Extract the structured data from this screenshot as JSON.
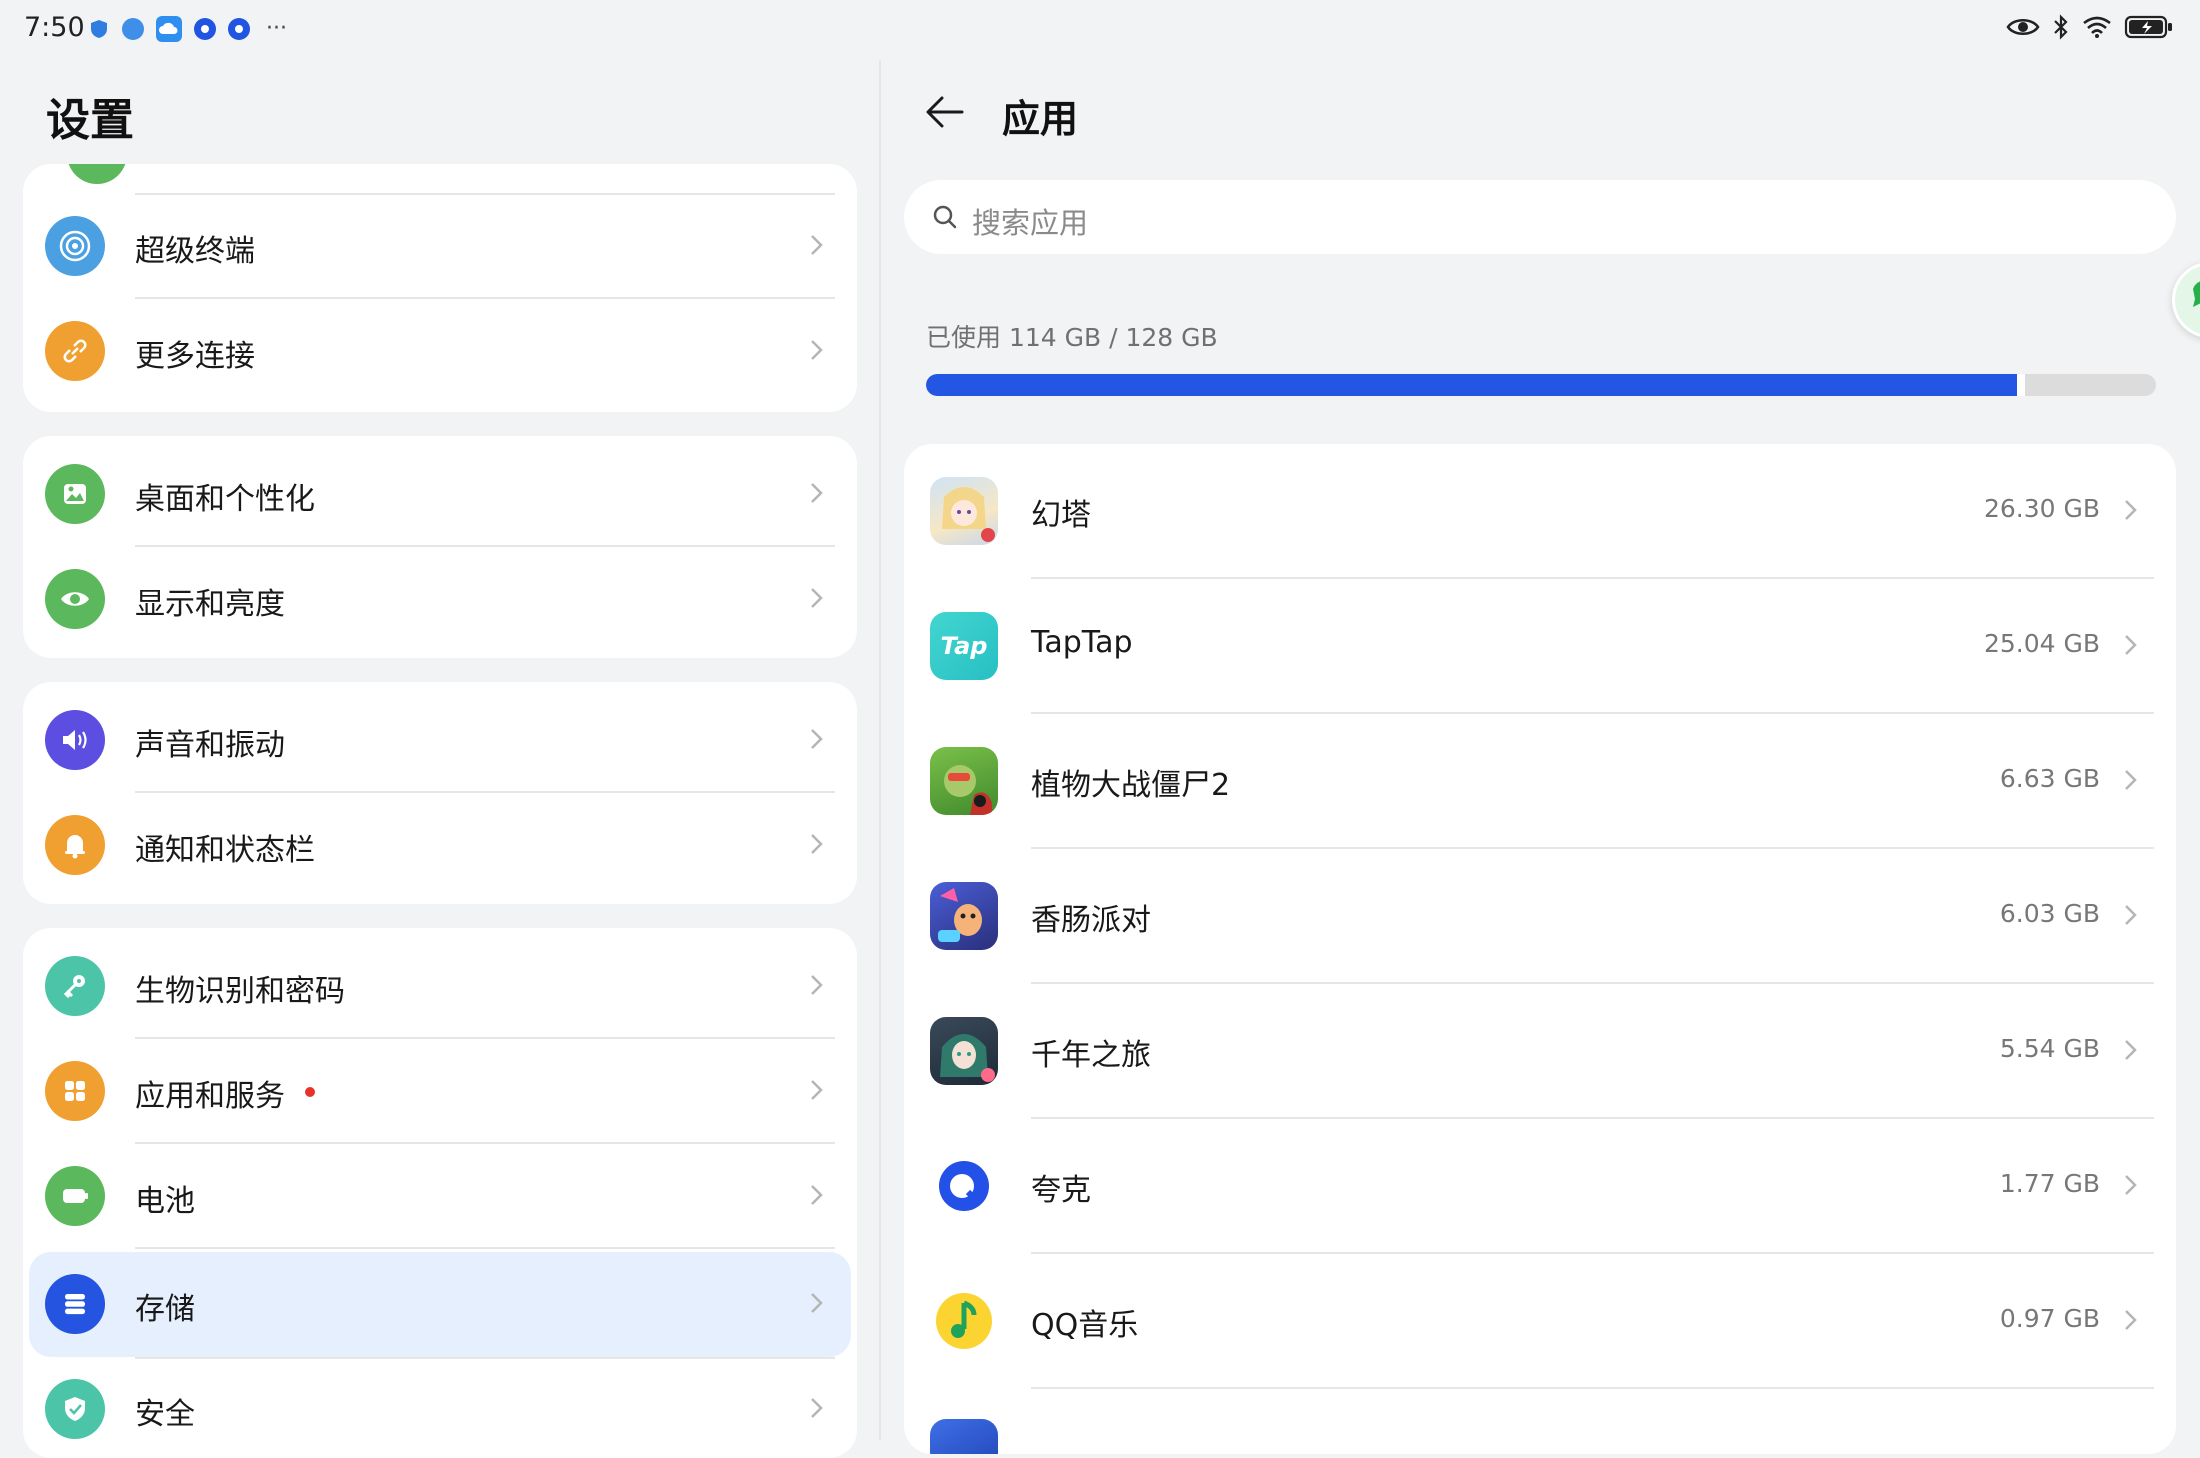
{
  "status_bar": {
    "time": "7:50",
    "notification_icons": [
      "shield-icon",
      "globe-icon",
      "cloud-icon",
      "browser-icon",
      "browser-icon",
      "more-dots-icon"
    ],
    "more": "···",
    "right_icons": [
      "eye-icon",
      "bluetooth-icon",
      "wifi-icon",
      "battery-charging-icon"
    ]
  },
  "settings": {
    "title": "设置",
    "items": [
      {
        "label": "超级终端",
        "icon": "super-device-icon",
        "color": "#4aa0e0"
      },
      {
        "label": "更多连接",
        "icon": "link-icon",
        "color": "#f0a030"
      },
      {
        "label": "桌面和个性化",
        "icon": "wallpaper-icon",
        "color": "#5cb85c"
      },
      {
        "label": "显示和亮度",
        "icon": "eye-icon",
        "color": "#5cb85c"
      },
      {
        "label": "声音和振动",
        "icon": "speaker-icon",
        "color": "#5b4ee0"
      },
      {
        "label": "通知和状态栏",
        "icon": "bell-icon",
        "color": "#f0a030"
      },
      {
        "label": "生物识别和密码",
        "icon": "key-icon",
        "color": "#4cc4a8"
      },
      {
        "label": "应用和服务",
        "icon": "apps-grid-icon",
        "color": "#f0a030",
        "badge": true
      },
      {
        "label": "电池",
        "icon": "battery-icon",
        "color": "#5cb85c"
      },
      {
        "label": "存储",
        "icon": "storage-icon",
        "color": "#2454e0",
        "selected": true
      },
      {
        "label": "安全",
        "icon": "shield-check-icon",
        "color": "#4cc4a8"
      }
    ]
  },
  "apps_page": {
    "title": "应用",
    "search_placeholder": "搜索应用",
    "storage_used_label": "已使用 114 GB / 128 GB",
    "storage_used_gb": 114,
    "storage_total_gb": 128,
    "accent_color": "#2456e4",
    "apps": [
      {
        "name": "幻塔",
        "size": "26.30 GB",
        "icon": "tower-of-fantasy-icon"
      },
      {
        "name": "TapTap",
        "size": "25.04 GB",
        "icon": "taptap-icon",
        "icon_text": "Tap"
      },
      {
        "name": "植物大战僵尸2",
        "size": "6.63 GB",
        "icon": "plants-vs-zombies-icon"
      },
      {
        "name": "香肠派对",
        "size": "6.03 GB",
        "icon": "sausage-man-icon"
      },
      {
        "name": "千年之旅",
        "size": "5.54 GB",
        "icon": "millennium-journey-icon"
      },
      {
        "name": "夸克",
        "size": "1.77 GB",
        "icon": "quark-icon"
      },
      {
        "name": "QQ音乐",
        "size": "0.97 GB",
        "icon": "qq-music-icon"
      }
    ]
  }
}
